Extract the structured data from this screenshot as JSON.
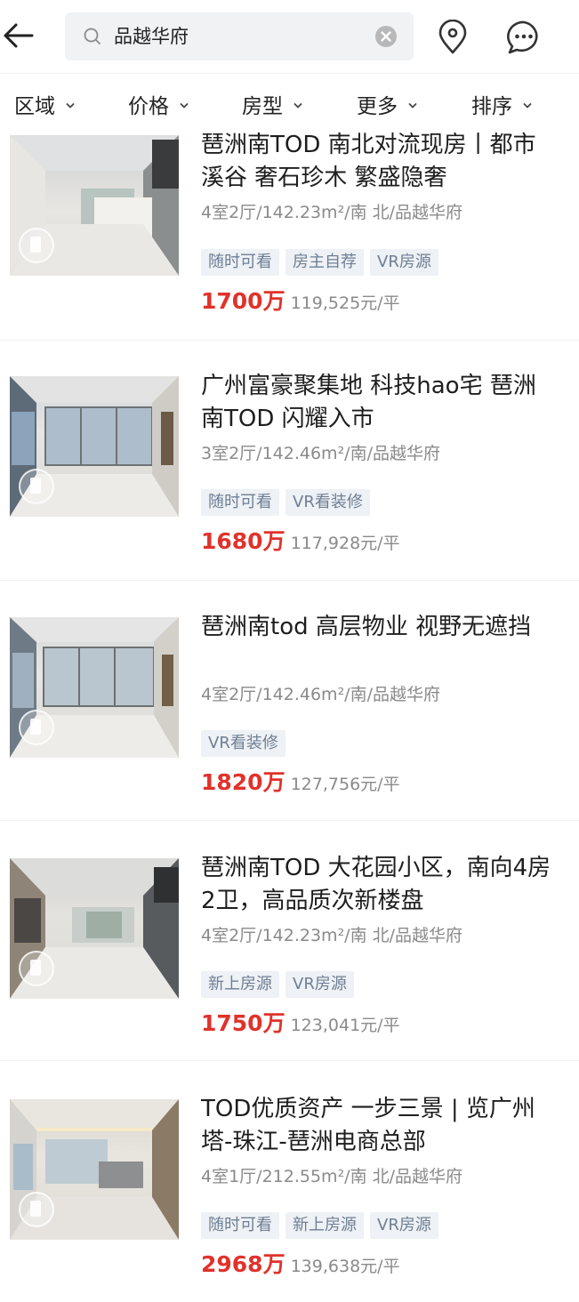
{
  "header": {
    "search_query": "品越华府"
  },
  "filters": [
    "区域",
    "价格",
    "房型",
    "更多",
    "排序"
  ],
  "listings": [
    {
      "title": "琶洲南TOD 南北对流现房丨都市溪谷 奢石珍木 繁盛隐奢",
      "meta": "4室2厅/142.23m²/南 北/品越华府",
      "tags": [
        "随时可看",
        "房主自荐",
        "VR房源"
      ],
      "price": "1700万",
      "unit_price": "119,525元/平"
    },
    {
      "title": "广州富豪聚集地 科技hao宅 琶洲南TOD 闪耀入市",
      "meta": "3室2厅/142.46m²/南/品越华府",
      "tags": [
        "随时可看",
        "VR看装修"
      ],
      "price": "1680万",
      "unit_price": "117,928元/平"
    },
    {
      "title": "琶洲南tod 高层物业 视野无遮挡",
      "meta": "4室2厅/142.46m²/南/品越华府",
      "tags": [
        "VR看装修"
      ],
      "price": "1820万",
      "unit_price": "127,756元/平"
    },
    {
      "title": "琶洲南TOD 大花园小区，南向4房2卫，高品质次新楼盘",
      "meta": "4室2厅/142.23m²/南 北/品越华府",
      "tags": [
        "新上房源",
        "VR房源"
      ],
      "price": "1750万",
      "unit_price": "123,041元/平"
    },
    {
      "title": "TOD优质资产 一步三景 | 览广州塔-珠江-琶洲电商总部",
      "meta": "4室1厅/212.55m²/南 北/品越华府",
      "tags": [
        "随时可看",
        "新上房源",
        "VR房源"
      ],
      "price": "2968万",
      "unit_price": "139,638元/平"
    }
  ]
}
